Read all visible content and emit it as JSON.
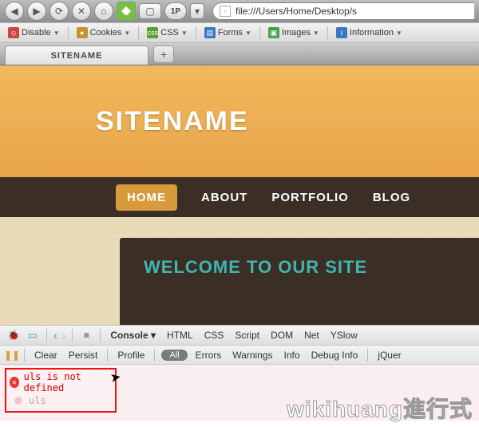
{
  "chrome": {
    "onep_label": "1P",
    "url": "file:///Users/Home/Desktop/s"
  },
  "devbar": {
    "disable": "Disable",
    "cookies": "Cookies",
    "css": "CSS",
    "forms": "Forms",
    "images": "Images",
    "information": "Information"
  },
  "tabs": {
    "active": "SITENAME",
    "add": "+"
  },
  "page": {
    "title": "SITENAME",
    "nav": {
      "home": "HOME",
      "about": "ABOUT",
      "portfolio": "PORTFOLIO",
      "blog": "BLOG"
    },
    "welcome": "WELCOME TO OUR SITE"
  },
  "firebug": {
    "tabs": {
      "console": "Console",
      "html": "HTML",
      "css": "CSS",
      "script": "Script",
      "dom": "DOM",
      "net": "Net",
      "yslow": "YSlow"
    },
    "toolbar": {
      "clear": "Clear",
      "persist": "Persist",
      "profile": "Profile",
      "all": "All",
      "errors": "Errors",
      "warnings": "Warnings",
      "info": "Info",
      "debuginfo": "Debug Info",
      "jquery": "jQuer"
    },
    "error": {
      "message": "uls is not defined",
      "detail": "uls"
    }
  },
  "watermark": "wikihuang進行式"
}
